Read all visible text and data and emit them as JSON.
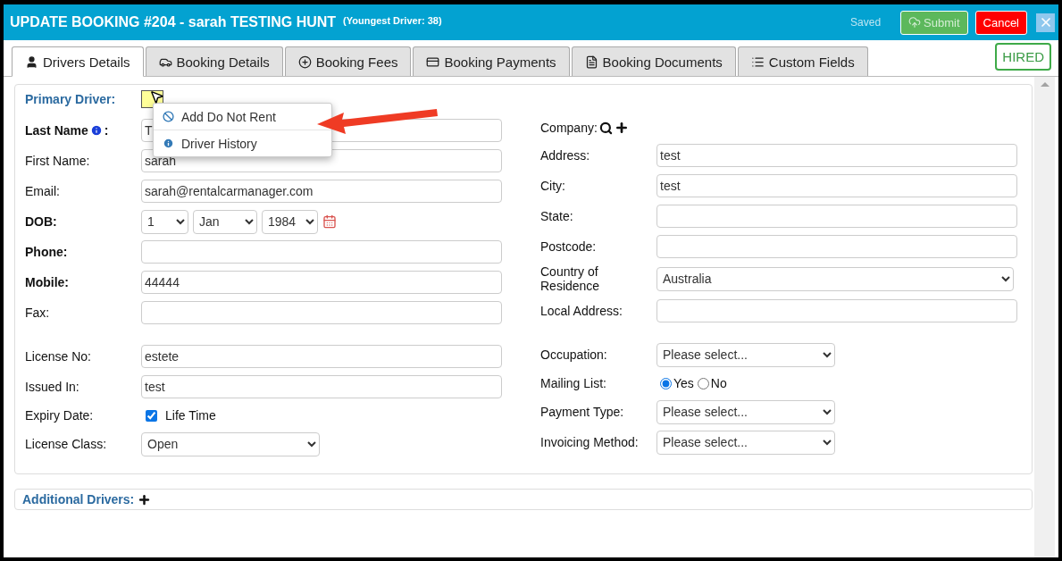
{
  "header": {
    "title": "UPDATE BOOKING #204 - sarah TESTING HUNT",
    "subtitle": "(Youngest Driver: 38)",
    "status": "Saved",
    "submit": "Submit",
    "cancel": "Cancel"
  },
  "tabs": [
    {
      "label": "Drivers Details",
      "selected": true
    },
    {
      "label": "Booking Details",
      "selected": false
    },
    {
      "label": "Booking Fees",
      "selected": false
    },
    {
      "label": "Booking Payments",
      "selected": false
    },
    {
      "label": "Booking Documents",
      "selected": false
    },
    {
      "label": "Custom Fields",
      "selected": false
    }
  ],
  "badge": "HIRED",
  "primary_driver": {
    "label": "Primary Driver:",
    "menu": [
      {
        "label": "Add Do Not Rent"
      },
      {
        "label": "Driver History"
      }
    ]
  },
  "left_fields": [
    {
      "kind": "text",
      "label": "Last Name",
      "bold": true,
      "info": true,
      "suffix": ":",
      "value": "T"
    },
    {
      "kind": "text",
      "label": "First Name:",
      "bold": false,
      "value": "sarah"
    },
    {
      "kind": "text",
      "label": "Email:",
      "bold": false,
      "value": "sarah@rentalcarmanager.com"
    },
    {
      "kind": "dob",
      "label": "DOB:",
      "bold": true,
      "day": "1",
      "month": "Jan",
      "year": "1984"
    },
    {
      "kind": "text",
      "label": "Phone:",
      "bold": true
    },
    {
      "kind": "text",
      "label": "Mobile:",
      "bold": true,
      "value": "44444"
    },
    {
      "kind": "text",
      "label": "Fax:",
      "bold": false
    },
    {
      "kind": "text",
      "label": "License No:",
      "bold": false,
      "value": "estete",
      "gap_before": true
    },
    {
      "kind": "text",
      "label": "Issued In:",
      "bold": false,
      "value": "test"
    },
    {
      "kind": "checkbox",
      "label": "Expiry Date:",
      "bold": false,
      "option": "Life Time",
      "checked": true
    },
    {
      "kind": "select",
      "label": "License Class:",
      "bold": false,
      "value": "Open"
    }
  ],
  "right_fields": [
    {
      "kind": "company",
      "label": "Company:"
    },
    {
      "kind": "text",
      "label": "Address:",
      "value": "test"
    },
    {
      "kind": "text",
      "label": "City:",
      "value": "test"
    },
    {
      "kind": "text",
      "label": "State:"
    },
    {
      "kind": "text",
      "label": "Postcode:"
    },
    {
      "kind": "wide_select",
      "label": "Country of Residence",
      "value": "Australia"
    },
    {
      "kind": "text",
      "label": "Local Address:"
    },
    {
      "kind": "select",
      "label": "Occupation:",
      "value": "Please select...",
      "gap_before": true
    },
    {
      "kind": "radio",
      "label": "Mailing List:",
      "options": [
        {
          "label": "Yes",
          "selected": true
        },
        {
          "label": "No",
          "selected": false
        }
      ]
    },
    {
      "kind": "select",
      "label": "Payment Type:",
      "value": "Please select..."
    },
    {
      "kind": "select",
      "label": "Invoicing Method:",
      "value": "Please select..."
    }
  ],
  "additional_drivers": {
    "label": "Additional Drivers:"
  }
}
